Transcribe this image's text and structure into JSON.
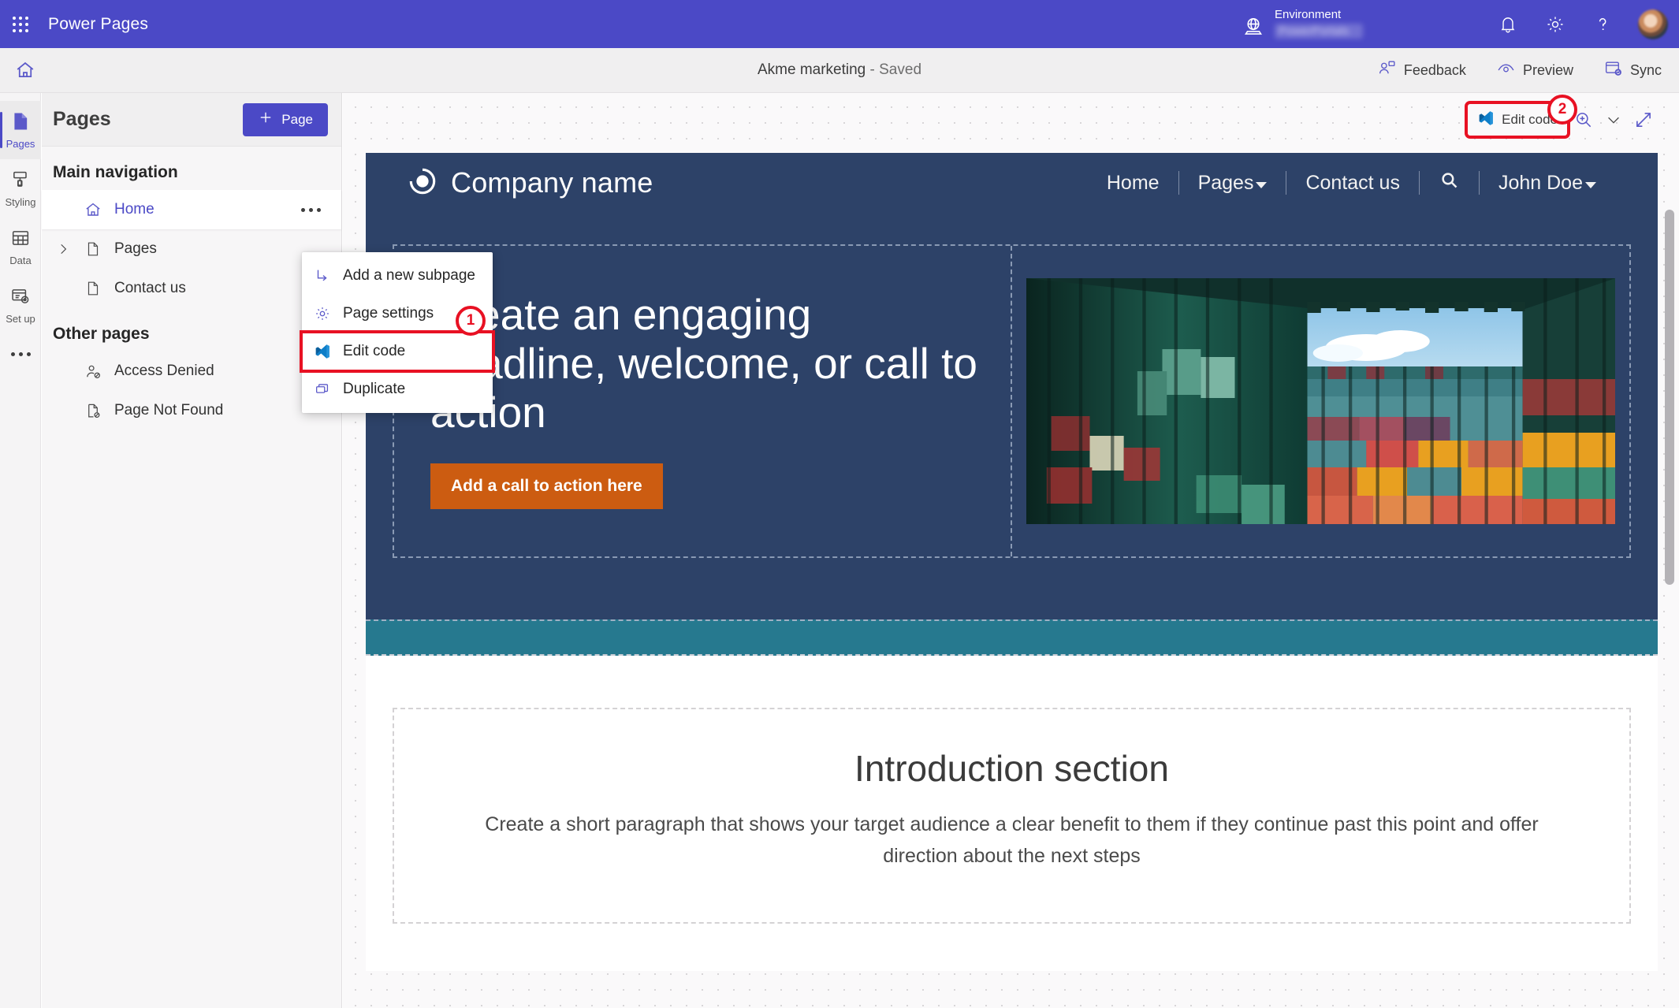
{
  "brandbar": {
    "waffle_name": "app-launcher",
    "title": "Power Pages",
    "environment_label": "Environment",
    "environment_name": "PowerPortals",
    "icons": [
      "globe-icon",
      "bell-icon",
      "gear-icon",
      "help-icon",
      "avatar"
    ]
  },
  "commandbar": {
    "home_icon": "home-icon",
    "doc_title": "Akme marketing",
    "doc_status": "- Saved",
    "actions": [
      {
        "label": "Feedback",
        "icon": "feedback-icon"
      },
      {
        "label": "Preview",
        "icon": "preview-eye-icon"
      },
      {
        "label": "Sync",
        "icon": "sync-icon"
      }
    ]
  },
  "rail": {
    "items": [
      {
        "label": "Pages",
        "icon": "page-icon",
        "active": true
      },
      {
        "label": "Styling",
        "icon": "paint-roller-icon",
        "active": false
      },
      {
        "label": "Data",
        "icon": "table-icon",
        "active": false
      },
      {
        "label": "Set up",
        "icon": "setup-icon",
        "active": false
      }
    ],
    "more_label": "more-options"
  },
  "panel": {
    "title": "Pages",
    "add_button": "Page",
    "groups": [
      {
        "title": "Main navigation",
        "items": [
          {
            "label": "Home",
            "icon": "home-icon",
            "selected": true,
            "expandable": false,
            "has_overflow": true
          },
          {
            "label": "Pages",
            "icon": "file-icon",
            "selected": false,
            "expandable": true,
            "has_overflow": false
          },
          {
            "label": "Contact us",
            "icon": "file-icon",
            "selected": false,
            "expandable": false,
            "has_overflow": false
          }
        ]
      },
      {
        "title": "Other pages",
        "items": [
          {
            "label": "Access Denied",
            "icon": "person-denied-icon",
            "selected": false,
            "expandable": false,
            "has_overflow": false
          },
          {
            "label": "Page Not Found",
            "icon": "file-denied-icon",
            "selected": false,
            "expandable": false,
            "has_overflow": false
          }
        ]
      }
    ]
  },
  "context_menu": {
    "items": [
      {
        "label": "Add a new subpage",
        "icon": "subpage-arrow-icon",
        "highlighted": false
      },
      {
        "label": "Page settings",
        "icon": "gear-icon",
        "highlighted": false
      },
      {
        "label": "Edit code",
        "icon": "vscode-icon",
        "highlighted": true
      },
      {
        "label": "Duplicate",
        "icon": "duplicate-icon",
        "highlighted": false
      }
    ]
  },
  "callouts": [
    {
      "number": "1"
    },
    {
      "number": "2"
    }
  ],
  "canvas_toolbar": {
    "edit_code_label": "Edit code",
    "edit_code_icon": "vscode-icon",
    "zoom_icon": "zoom-in-icon",
    "chevron_icon": "chevron-down-icon",
    "expand_icon": "expand-diagonal-icon"
  },
  "site_preview": {
    "logo_icon": "circle-logo-icon",
    "company_name": "Company name",
    "nav_links": [
      {
        "label": "Home",
        "has_caret": false
      },
      {
        "label": "Pages",
        "has_caret": true
      },
      {
        "label": "Contact us",
        "has_caret": false
      },
      {
        "label": "",
        "has_caret": false,
        "icon": "search-icon"
      },
      {
        "label": "John Doe",
        "has_caret": true
      }
    ],
    "hero": {
      "headline": "Create an engaging headline, welcome, or call to action",
      "cta_label": "Add a call to action here",
      "image_alt": "shipping-containers-photo"
    },
    "intro": {
      "heading": "Introduction section",
      "paragraph": "Create a short paragraph that shows your target audience a clear benefit to them if they continue past this point and offer direction about the next steps"
    }
  },
  "colors": {
    "brand_purple": "#4b49c6",
    "site_navy": "#2d4268",
    "site_teal": "#26798f",
    "cta_orange": "#cc5c11",
    "callout_red": "#e81123"
  }
}
